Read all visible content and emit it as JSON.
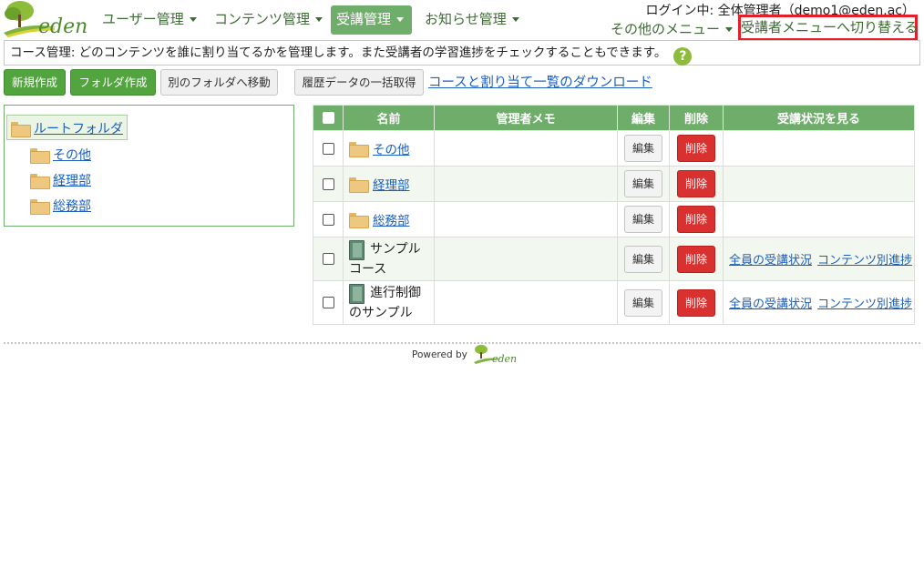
{
  "header": {
    "logo_text": "eden",
    "nav": [
      {
        "label": "ユーザー管理"
      },
      {
        "label": "コンテンツ管理"
      },
      {
        "label": "受講管理"
      },
      {
        "label": "お知らせ管理"
      }
    ],
    "login_info": "ログイン中: 全体管理者（demo1@eden.ac）",
    "other_menu": "その他のメニュー",
    "switch_menu": "受講者メニューへ切り替える",
    "accent_color": "#6fae6a",
    "highlight_color": "#e51f2a"
  },
  "info_bar": {
    "text": "コース管理: どのコンテンツを誰に割り当てるかを管理します。また受講者の学習進捗をチェックすることもできます。",
    "help_icon": "?"
  },
  "toolbar": {
    "new_label": "新規作成",
    "folder_label": "フォルダ作成",
    "move_label": "別のフォルダへ移動",
    "history_label": "履歴データの一括取得",
    "download_label": "コースと割り当て一覧のダウンロード"
  },
  "tree": {
    "root": "ルートフォルダ",
    "children": [
      "その他",
      "経理部",
      "総務部"
    ]
  },
  "table": {
    "headers": {
      "name": "名前",
      "memo": "管理者メモ",
      "edit": "編集",
      "delete": "削除",
      "status": "受講状況を見る"
    },
    "rows": [
      {
        "type": "folder",
        "name": "その他",
        "memo": "",
        "edit": "編集",
        "delete": "削除"
      },
      {
        "type": "folder",
        "name": "経理部",
        "memo": "",
        "edit": "編集",
        "delete": "削除"
      },
      {
        "type": "folder",
        "name": "総務部",
        "memo": "",
        "edit": "編集",
        "delete": "削除"
      },
      {
        "type": "course",
        "name_line1": "サンプル",
        "name_line2": "コース",
        "memo": "",
        "edit": "編集",
        "delete": "削除",
        "status_all": "全員の受講状況",
        "status_content": "コンテンツ別進捗"
      },
      {
        "type": "course",
        "name_line1": "進行制御",
        "name_line2": "のサンプル",
        "memo": "",
        "edit": "編集",
        "delete": "削除",
        "status_all": "全員の受講状況",
        "status_content": "コンテンツ別進捗"
      }
    ]
  },
  "footer": {
    "powered_by": "Powered by",
    "logo_text": "eden"
  }
}
